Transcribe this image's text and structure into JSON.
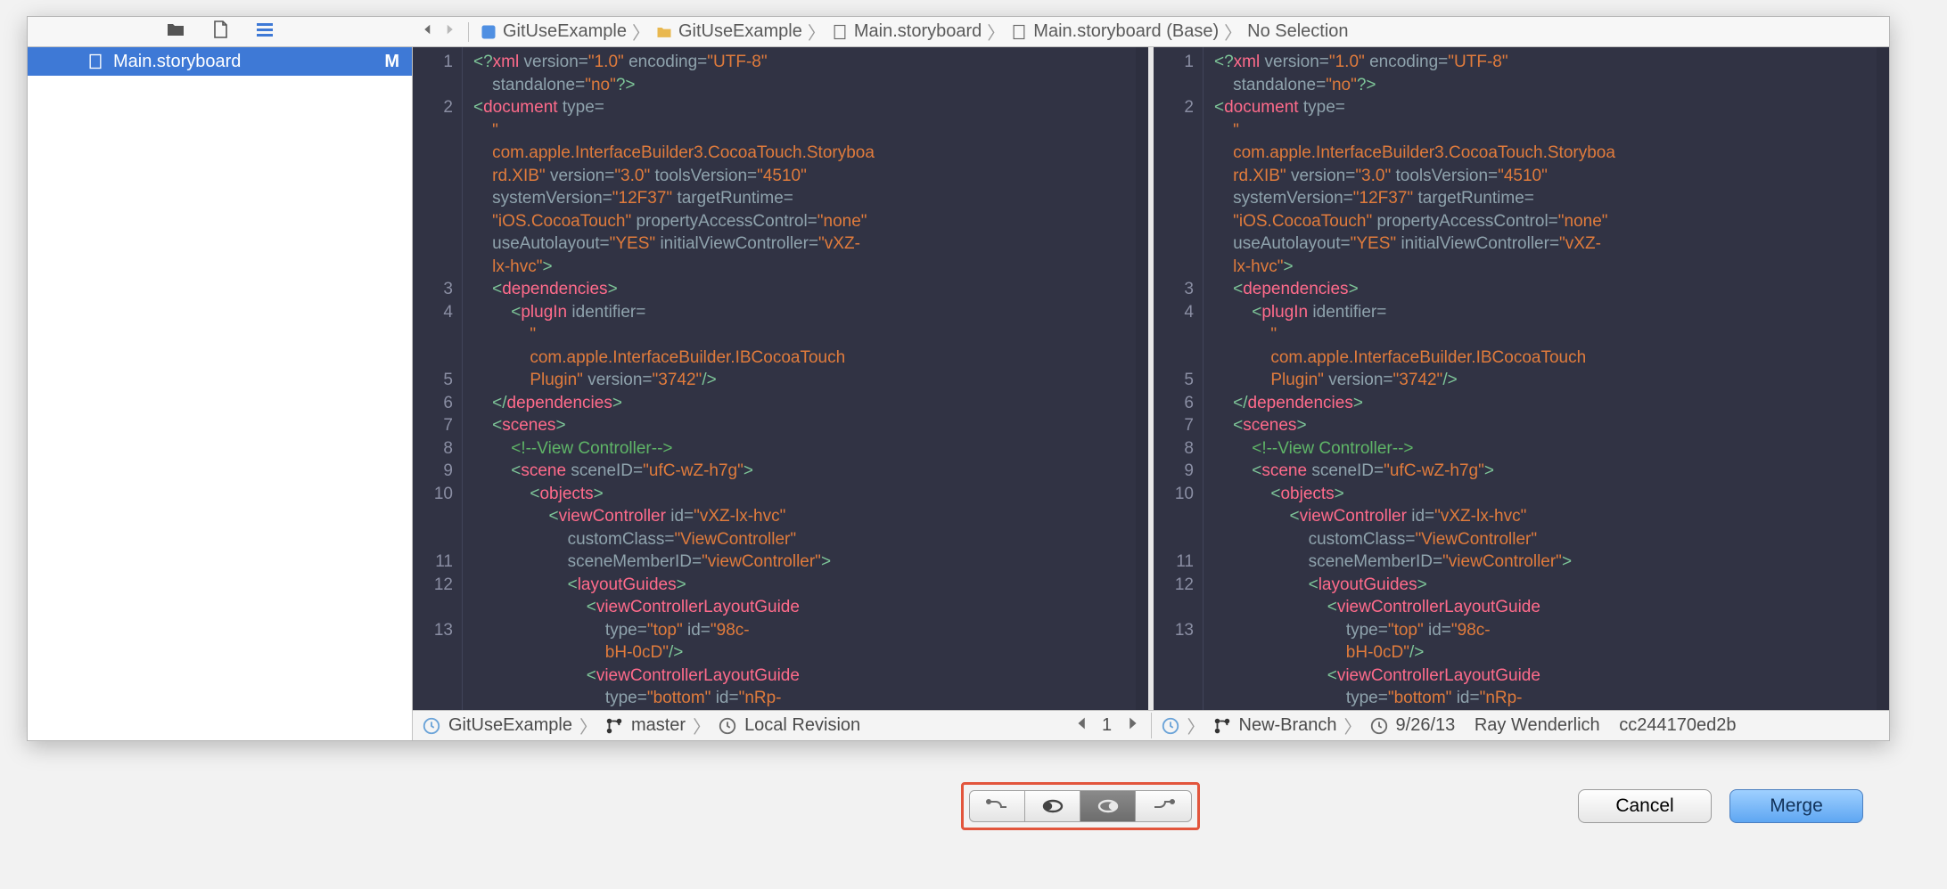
{
  "sidebar": {
    "file": {
      "name": "Main.storyboard",
      "badge": "M"
    }
  },
  "breadcrumb": {
    "items": [
      "GitUseExample",
      "GitUseExample",
      "Main.storyboard",
      "Main.storyboard (Base)",
      "No Selection"
    ]
  },
  "gutter": [
    "1",
    "2",
    "3",
    "4",
    "5",
    "6",
    "7",
    "8",
    "9",
    "10",
    "11",
    "12",
    "13"
  ],
  "status_left": {
    "project": "GitUseExample",
    "branch": "master",
    "revision": "Local Revision",
    "page": "1"
  },
  "status_right": {
    "branch": "New-Branch",
    "date": "9/26/13",
    "author": "Ray Wenderlich",
    "commit": "cc244170ed2b"
  },
  "buttons": {
    "cancel": "Cancel",
    "merge": "Merge"
  }
}
